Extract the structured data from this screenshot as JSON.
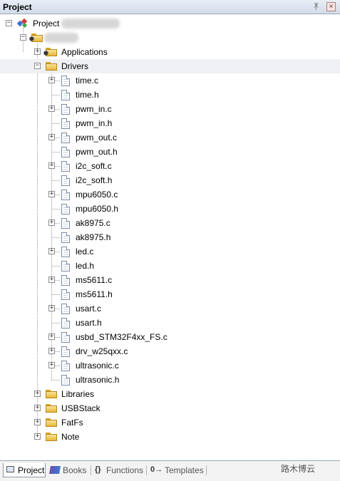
{
  "window": {
    "title": "Project",
    "pin_glyph": "ᛡ",
    "close_glyph": "×"
  },
  "tree": {
    "root_label": "Project",
    "groups_top": [
      {
        "label": "Applications",
        "expander": "+"
      },
      {
        "label": "Drivers",
        "expander": "−"
      }
    ],
    "driver_files": [
      {
        "name": "time.c",
        "expander": "+"
      },
      {
        "name": "time.h",
        "expander": ""
      },
      {
        "name": "pwm_in.c",
        "expander": "+"
      },
      {
        "name": "pwm_in.h",
        "expander": ""
      },
      {
        "name": "pwm_out.c",
        "expander": "+"
      },
      {
        "name": "pwm_out.h",
        "expander": ""
      },
      {
        "name": "i2c_soft.c",
        "expander": "+"
      },
      {
        "name": "i2c_soft.h",
        "expander": ""
      },
      {
        "name": "mpu6050.c",
        "expander": "+"
      },
      {
        "name": "mpu6050.h",
        "expander": ""
      },
      {
        "name": "ak8975.c",
        "expander": "+"
      },
      {
        "name": "ak8975.h",
        "expander": ""
      },
      {
        "name": "led.c",
        "expander": "+"
      },
      {
        "name": "led.h",
        "expander": ""
      },
      {
        "name": "ms5611.c",
        "expander": "+"
      },
      {
        "name": "ms5611.h",
        "expander": ""
      },
      {
        "name": "usart.c",
        "expander": "+"
      },
      {
        "name": "usart.h",
        "expander": ""
      },
      {
        "name": "usbd_STM32F4xx_FS.c",
        "expander": "+"
      },
      {
        "name": "drv_w25qxx.c",
        "expander": "+"
      },
      {
        "name": "ultrasonic.c",
        "expander": "+"
      },
      {
        "name": "ultrasonic.h",
        "expander": ""
      }
    ],
    "groups_bottom": [
      {
        "label": "Libraries",
        "expander": "+"
      },
      {
        "label": "USBStack",
        "expander": "+"
      },
      {
        "label": "FatFs",
        "expander": "+"
      },
      {
        "label": "Note",
        "expander": "+"
      }
    ]
  },
  "bottom_tabs": [
    {
      "label": "Project",
      "active": true
    },
    {
      "label": "Books",
      "active": false
    },
    {
      "label": "Functions",
      "active": false,
      "icon_glyph": "{}"
    },
    {
      "label": "Templates",
      "active": false,
      "icon_glyph": "0→"
    }
  ],
  "watermark": "路木博云",
  "colors": {
    "accent": "#d3dcea",
    "selected_row": "#eef0f3",
    "folder": "#e8b838"
  }
}
